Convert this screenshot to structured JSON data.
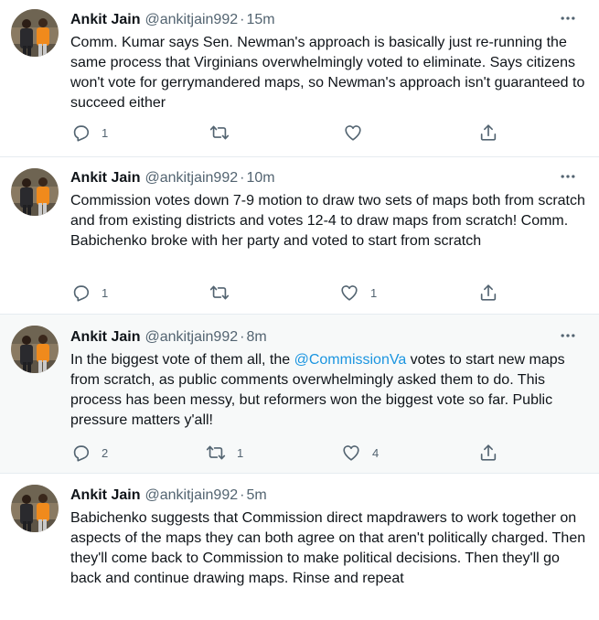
{
  "tweets": [
    {
      "name": "Ankit Jain",
      "handle": "@ankitjain992",
      "separator": "·",
      "time": "15m",
      "text": "Comm. Kumar says Sen. Newman's approach is basically just re-running the same process that Virginians overwhelmingly voted to eliminate. Says citizens won't vote for gerrymandered maps, so Newman's approach isn't guaranteed to succeed either",
      "reply_count": "1",
      "retweet_count": "",
      "like_count": "",
      "highlight": false
    },
    {
      "name": "Ankit Jain",
      "handle": "@ankitjain992",
      "separator": "·",
      "time": "10m",
      "text": "Commission votes down 7-9 motion to draw two sets of maps both from scratch and from existing districts and votes 12-4 to draw maps from scratch! Comm. Babichenko broke with her party and voted to start from scratch",
      "reply_count": "1",
      "retweet_count": "",
      "like_count": "1",
      "highlight": false
    },
    {
      "name": "Ankit Jain",
      "handle": "@ankitjain992",
      "separator": "·",
      "time": "8m",
      "text_before": "In the biggest vote of them all, the ",
      "mention": "@CommissionVa",
      "text_after": " votes to start new maps from scratch, as public comments overwhelmingly asked them to do. This process has been messy, but reformers won the biggest vote so far. Public pressure matters y'all!",
      "reply_count": "2",
      "retweet_count": "1",
      "like_count": "4",
      "highlight": true
    },
    {
      "name": "Ankit Jain",
      "handle": "@ankitjain992",
      "separator": "·",
      "time": "5m",
      "text": "Babichenko suggests that Commission direct mapdrawers to work together on aspects of the maps they can both agree on that aren't politically charged. Then they'll come back to Commission to make political decisions. Then they'll go back and continue drawing maps. Rinse and repeat",
      "highlight": false
    }
  ],
  "icons": {
    "more": "more-horizontal-icon",
    "reply": "reply-icon",
    "retweet": "retweet-icon",
    "like": "heart-icon",
    "share": "share-icon"
  },
  "colors": {
    "text": "#0f1419",
    "secondary": "#536471",
    "mention": "#1b95e0",
    "highlight_bg": "#f7f9f9",
    "divider": "#e6ecf0"
  }
}
